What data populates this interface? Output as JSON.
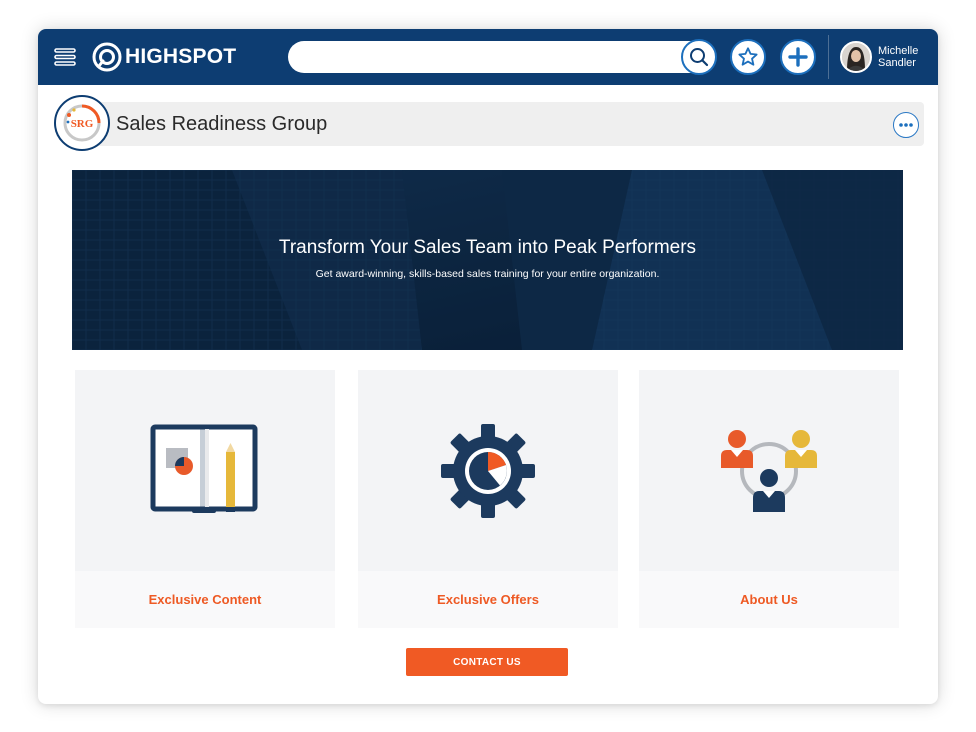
{
  "app": {
    "brand": "HIGHSPOT"
  },
  "search": {
    "value": "",
    "placeholder": ""
  },
  "user": {
    "first_name": "Michelle",
    "last_name": "Sandler"
  },
  "group": {
    "title": "Sales Readiness Group",
    "logo_text": "SRG"
  },
  "hero": {
    "title": "Transform Your Sales Team into Peak Performers",
    "subtitle": "Get award-winning, skills-based sales training for your entire organization."
  },
  "cards": [
    {
      "label": "Exclusive Content",
      "icon": "presentation-board-icon"
    },
    {
      "label": "Exclusive Offers",
      "icon": "gear-pie-chart-icon"
    },
    {
      "label": "About Us",
      "icon": "team-people-icon"
    }
  ],
  "contact_button": {
    "label": "CONTACT US"
  },
  "colors": {
    "nav_bg": "#0d3d72",
    "accent_orange": "#f05a24",
    "accent_blue": "#1c6fbd",
    "icon_navy": "#1c3a5e",
    "icon_yellow": "#e6b83a"
  }
}
